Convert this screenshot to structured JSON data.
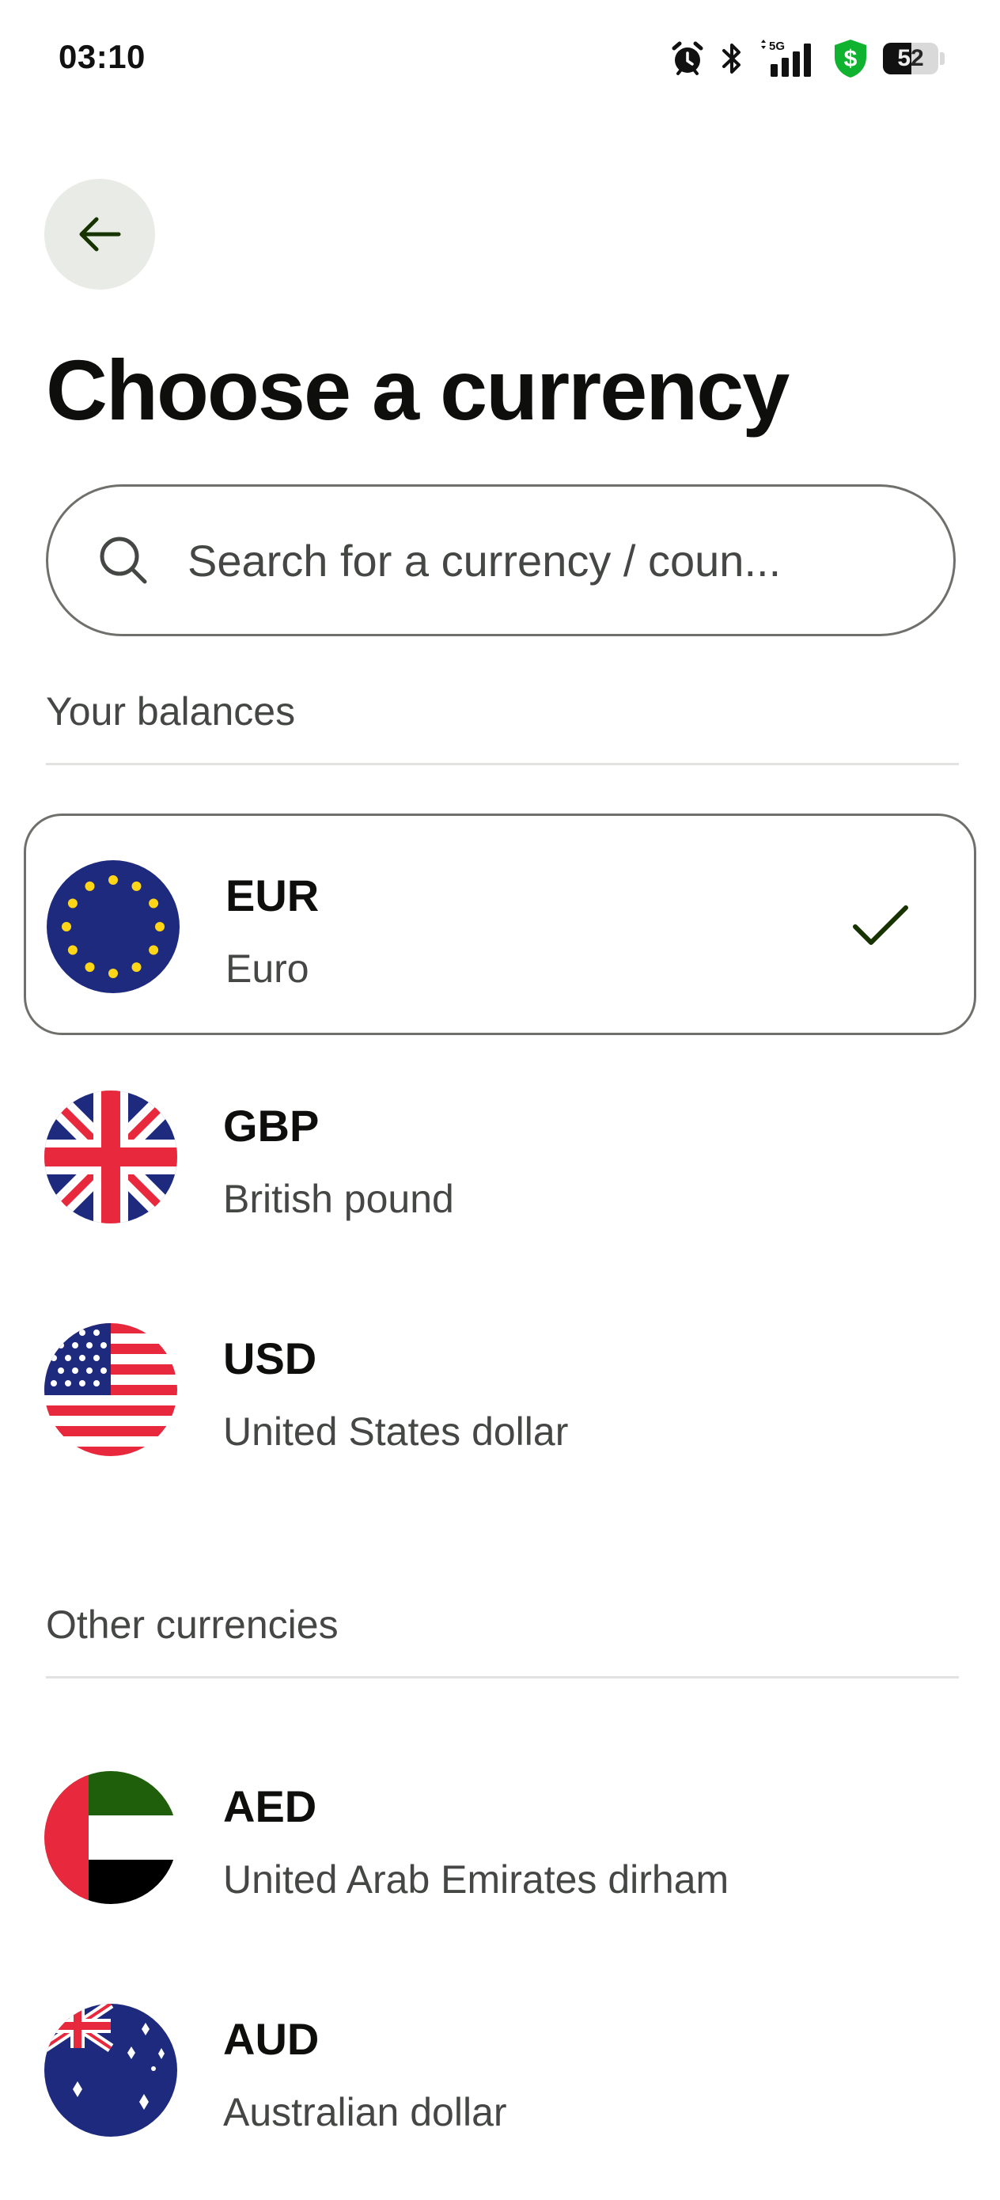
{
  "status_bar": {
    "time": "03:10",
    "icons": [
      "alarm-icon",
      "bluetooth-icon",
      "5g-signal-icon",
      "shield-dollar-icon",
      "battery-icon"
    ],
    "network": "5G",
    "battery_level": "52",
    "shield_symbol": "$"
  },
  "header": {
    "back_icon": "arrow-left-icon",
    "title": "Choose a currency"
  },
  "search": {
    "placeholder": "Search for a currency / coun...",
    "value": ""
  },
  "sections": {
    "balances_label": "Your balances",
    "other_label": "Other currencies"
  },
  "balances": [
    {
      "code": "EUR",
      "name": "Euro",
      "flag": "eu-flag-icon",
      "selected": true
    },
    {
      "code": "GBP",
      "name": "British pound",
      "flag": "uk-flag-icon",
      "selected": false
    },
    {
      "code": "USD",
      "name": "United States dollar",
      "flag": "us-flag-icon",
      "selected": false
    }
  ],
  "other_currencies": [
    {
      "code": "AED",
      "name": "United Arab Emirates dirham",
      "flag": "uae-flag-icon"
    },
    {
      "code": "AUD",
      "name": "Australian dollar",
      "flag": "au-flag-icon"
    }
  ],
  "colors": {
    "check": "#163300",
    "back_bg": "#e8ebe6",
    "text_primary": "#0e0f0c",
    "text_secondary": "#454745"
  }
}
